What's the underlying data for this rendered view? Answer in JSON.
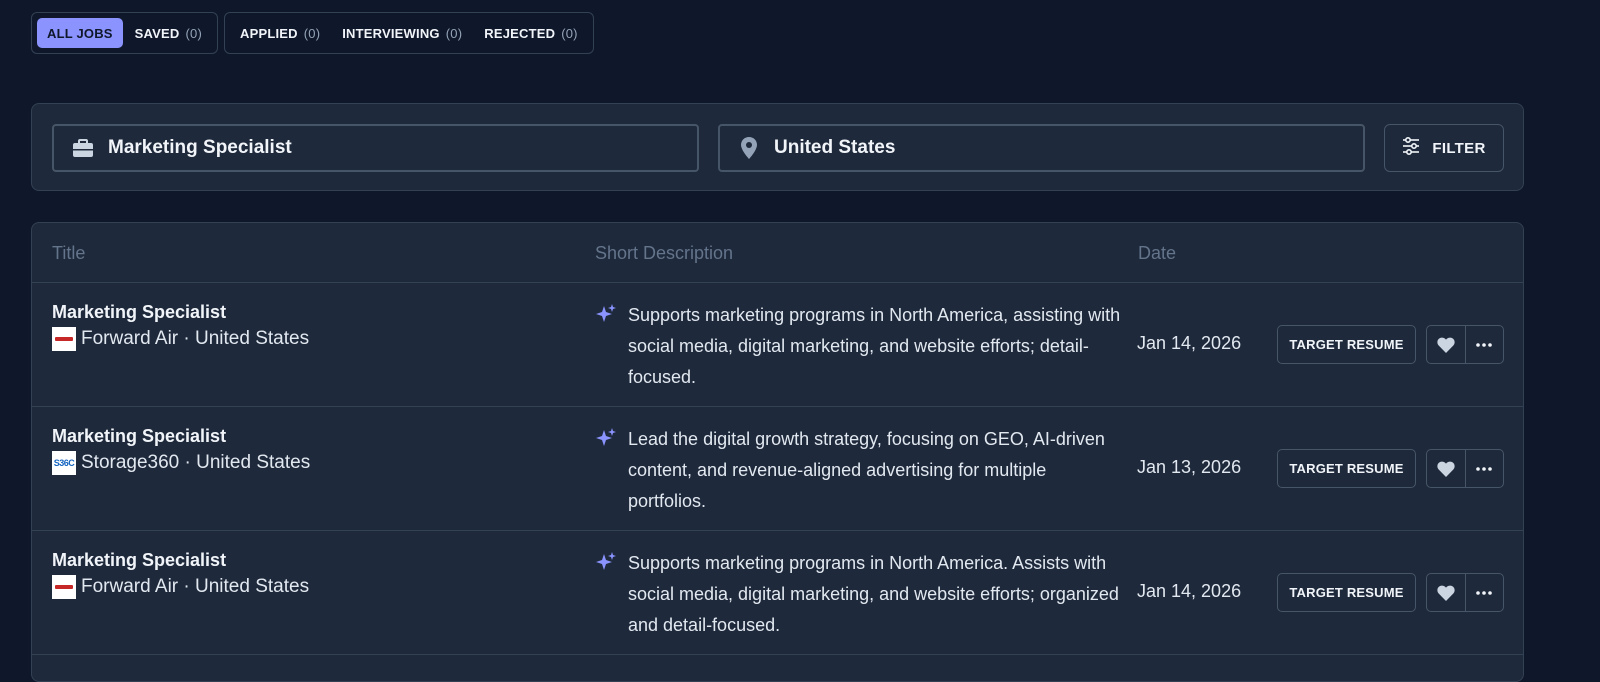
{
  "tabs": {
    "group1": [
      {
        "label": "ALL JOBS",
        "count": "",
        "active": true
      },
      {
        "label": "SAVED",
        "count": "(0)",
        "active": false
      }
    ],
    "group2": [
      {
        "label": "APPLIED",
        "count": "(0)",
        "active": false
      },
      {
        "label": "INTERVIEWING",
        "count": "(0)",
        "active": false
      },
      {
        "label": "REJECTED",
        "count": "(0)",
        "active": false
      }
    ]
  },
  "search": {
    "job_title_value": "Marketing Specialist",
    "job_title_icon": "briefcase-icon",
    "location_value": "United States",
    "location_icon": "map-pin-icon",
    "filter_label": "FILTER",
    "filter_icon": "sliders-icon"
  },
  "table": {
    "headers": {
      "title": "Title",
      "description": "Short Description",
      "date": "Date"
    },
    "rows": [
      {
        "title": "Marketing Specialist",
        "company": "Forward Air",
        "location": "United States",
        "company_line": "Forward Air · United States",
        "logo": "forward-air-logo",
        "description": "Supports marketing programs in North America, assisting with social media, digital marketing, and website efforts; detail-focused.",
        "date": "Jan 14, 2026",
        "action_label": "TARGET RESUME"
      },
      {
        "title": "Marketing Specialist",
        "company": "Storage360",
        "location": "United States",
        "company_line": "Storage360 · United States",
        "logo": "storage360-logo",
        "logo_text": "S36C",
        "description": "Lead the digital growth strategy, focusing on GEO, AI-driven content, and revenue-aligned advertising for multiple portfolios.",
        "date": "Jan 13, 2026",
        "action_label": "TARGET RESUME"
      },
      {
        "title": "Marketing Specialist",
        "company": "Forward Air",
        "location": "United States",
        "company_line": "Forward Air · United States",
        "logo": "forward-air-logo",
        "description": "Supports marketing programs in North America. Assists with social media, digital marketing, and website efforts; organized and detail-focused.",
        "date": "Jan 14, 2026",
        "action_label": "TARGET RESUME"
      }
    ]
  },
  "colors": {
    "background": "#0f172a",
    "panel": "#1e293b",
    "border": "#334155",
    "accent": "#8b93ff",
    "text": "#f1f5f9",
    "muted": "#64748b"
  }
}
